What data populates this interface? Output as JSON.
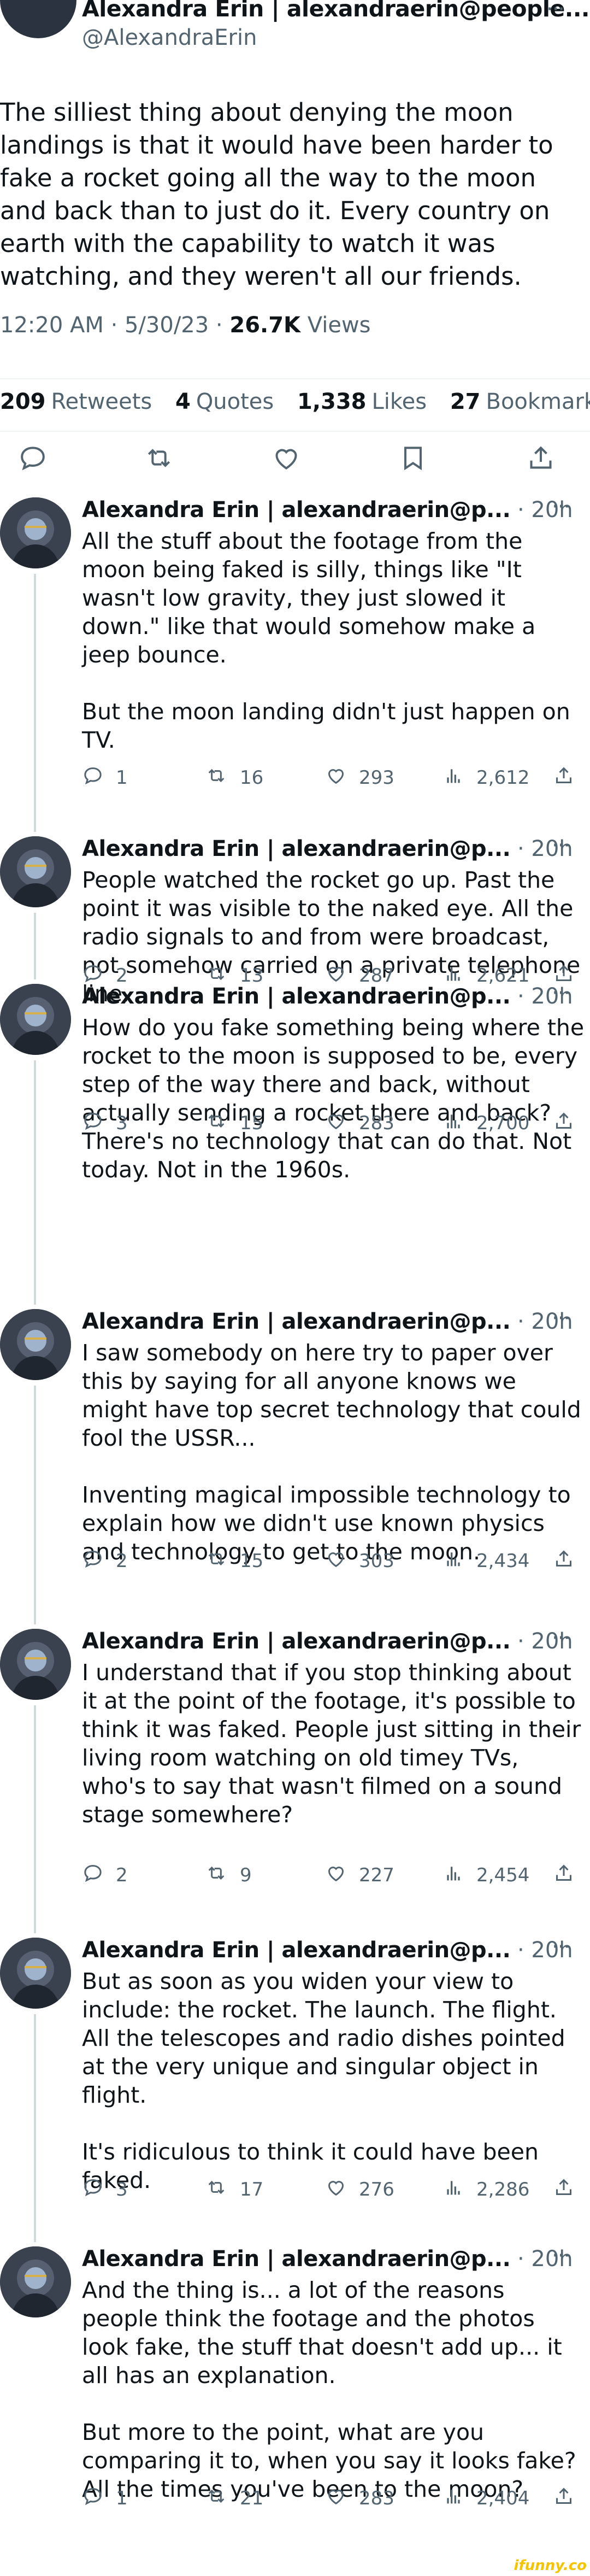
{
  "main_tweet": {
    "author_name": "Alexandra Erin | alexandraerin@people...",
    "author_handle": "@AlexandraErin",
    "more_label": "···",
    "text": "The silliest thing about denying the moon landings is that it would have been harder to fake a rocket going all the way to the moon and back than to just do it. Every country on earth with the capability to watch it was watching, and they weren't all our friends.",
    "time": "12:20 AM · 5/30/23 · ",
    "views_count": "26.7K",
    "views_label": " Views",
    "retweets_count": "209",
    "retweets_label": "Retweets",
    "quotes_count": "4",
    "quotes_label": "Quotes",
    "likes_count": "1,338",
    "likes_label": "Likes",
    "bookmarks_count": "27",
    "bookmarks_label": "Bookmarks",
    "action_icons": [
      "reply-icon",
      "retweet-icon",
      "like-icon",
      "bookmark-icon",
      "share-icon"
    ]
  },
  "replies": [
    {
      "name": "Alexandra Erin | alexandraerin@p...",
      "time": " · 20h",
      "paragraphs": [
        "All the stuff about the footage from the moon being faked is silly, things like \"It wasn't low gravity, they just slowed it down.\" like that would somehow make a jeep bounce.",
        "But the moon landing didn't just happen on TV."
      ],
      "replies": "1",
      "retweets": "16",
      "likes": "293",
      "views": "2,612"
    },
    {
      "name": "Alexandra Erin | alexandraerin@p...",
      "time": " · 20h",
      "paragraphs": [
        "People watched the rocket go up. Past the point it was visible to the naked eye. All the radio signals to and from were broadcast, not somehow carried on a private telephone line."
      ],
      "replies": "2",
      "retweets": "13",
      "likes": "287",
      "views": "2,621"
    },
    {
      "name": "Alexandra Erin | alexandraerin@p...",
      "time": " · 20h",
      "paragraphs": [
        "How do you fake something being where the rocket to the moon is supposed to be, every step of the way there and back, without actually sending a rocket there and back? There's no technology that can do that. Not today. Not in the 1960s."
      ],
      "replies": "3",
      "retweets": "15",
      "likes": "283",
      "views": "2,700"
    },
    {
      "name": "Alexandra Erin | alexandraerin@p...",
      "time": " · 20h",
      "paragraphs": [
        "I saw somebody on here try to paper over this by saying for all anyone knows we might have top secret technology that could fool the USSR...",
        "Inventing magical impossible technology to explain how we didn't use known physics and technology to get to the moon."
      ],
      "replies": "2",
      "retweets": "15",
      "likes": "303",
      "views": "2,434"
    },
    {
      "name": "Alexandra Erin | alexandraerin@p...",
      "time": " · 20h",
      "paragraphs": [
        "I understand that if you stop thinking about it at the point of the footage, it's possible to think it was faked. People just sitting in their living room watching on old timey TVs, who's to say that wasn't filmed on a sound stage somewhere?"
      ],
      "replies": "2",
      "retweets": "9",
      "likes": "227",
      "views": "2,454"
    },
    {
      "name": "Alexandra Erin | alexandraerin@p...",
      "time": " · 20h",
      "paragraphs": [
        "But as soon as you widen your view to include: the rocket. The launch. The flight. All the telescopes and radio dishes pointed at the very unique and singular object in flight.",
        "It's ridiculous to think it could have been faked."
      ],
      "replies": "3",
      "retweets": "17",
      "likes": "276",
      "views": "2,286"
    },
    {
      "name": "Alexandra Erin | alexandraerin@p...",
      "time": " · 20h",
      "paragraphs": [
        "And the thing is... a lot of the reasons people think the footage and the photos look fake, the stuff that doesn't add up... it all has an explanation.",
        "But more to the point, what are you comparing it to, when you say it looks fake? All the times you've been to the moon?"
      ],
      "replies": "1",
      "retweets": "21",
      "likes": "283",
      "views": "2,404"
    }
  ],
  "watermark": "ifunny.co",
  "colors": {
    "text": "#0f1419",
    "secondary": "#536471",
    "divider": "#eff3f4",
    "watermark": "#f5c400"
  }
}
